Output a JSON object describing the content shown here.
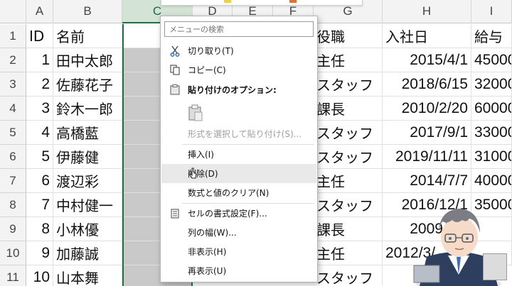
{
  "columns": [
    "A",
    "B",
    "C",
    "D",
    "E",
    "F",
    "G",
    "H",
    "I"
  ],
  "selected_column": "C",
  "rows": [
    "1",
    "2",
    "3",
    "4",
    "5",
    "6",
    "7",
    "8",
    "9",
    "10",
    "11"
  ],
  "header_row": {
    "a": "ID",
    "b": "名前",
    "g": "役職",
    "h": "入社日",
    "i": "給与"
  },
  "data_rows": [
    {
      "id": "1",
      "name": "田中太郎",
      "role": "主任",
      "date": "2015/4/1",
      "pay": "45000"
    },
    {
      "id": "2",
      "name": "佐藤花子",
      "role": "スタッフ",
      "date": "2018/6/15",
      "pay": "32000"
    },
    {
      "id": "3",
      "name": "鈴木一郎",
      "role": "課長",
      "date": "2010/2/20",
      "pay": "60000"
    },
    {
      "id": "4",
      "name": "高橋藍",
      "role": "スタッフ",
      "date": "2017/9/1",
      "pay": "33000"
    },
    {
      "id": "5",
      "name": "伊藤健",
      "role": "スタッフ",
      "date": "2019/11/11",
      "pay": "31000"
    },
    {
      "id": "6",
      "name": "渡辺彩",
      "role": "主任",
      "date": "2014/7/7",
      "pay": "40000"
    },
    {
      "id": "7",
      "name": "中村健一",
      "role": "スタッフ",
      "date": "2016/12/1",
      "pay": "35000"
    },
    {
      "id": "8",
      "name": "小林優",
      "role": "課長",
      "date": "2009/5/2",
      "pay": ""
    },
    {
      "id": "9",
      "name": "加藤誠",
      "role": "主任",
      "date": "2012/3/",
      "pay": ""
    },
    {
      "id": "10",
      "name": "山本舞",
      "role": "スタッフ",
      "date": "",
      "pay": ""
    }
  ],
  "context_menu": {
    "search_placeholder": "メニューの検索",
    "items": [
      {
        "label": "切り取り(T)",
        "icon": "scissors-icon",
        "disabled": false
      },
      {
        "label": "コピー(C)",
        "icon": "copy-icon",
        "disabled": false
      },
      {
        "label": "貼り付けのオプション:",
        "icon": "paste-icon",
        "disabled": false
      },
      {
        "label": "形式を選択して貼り付け(S)...",
        "icon": "",
        "disabled": true
      },
      {
        "label": "挿入(I)",
        "icon": "",
        "disabled": false
      },
      {
        "label": "削除(D)",
        "icon": "",
        "disabled": false
      },
      {
        "label": "数式と値のクリア(N)",
        "icon": "",
        "disabled": false
      },
      {
        "label": "セルの書式設定(F)...",
        "icon": "format-cells-icon",
        "disabled": false
      },
      {
        "label": "列の幅(W)...",
        "icon": "",
        "disabled": false
      },
      {
        "label": "非表示(H)",
        "icon": "",
        "disabled": false
      },
      {
        "label": "再表示(U)",
        "icon": "",
        "disabled": false
      }
    ],
    "hovered_item": "削除(D)"
  },
  "colors": {
    "accent": "#1e7145",
    "selection_fill": "#c9c9c9",
    "header_bg": "#f3f3f3"
  }
}
